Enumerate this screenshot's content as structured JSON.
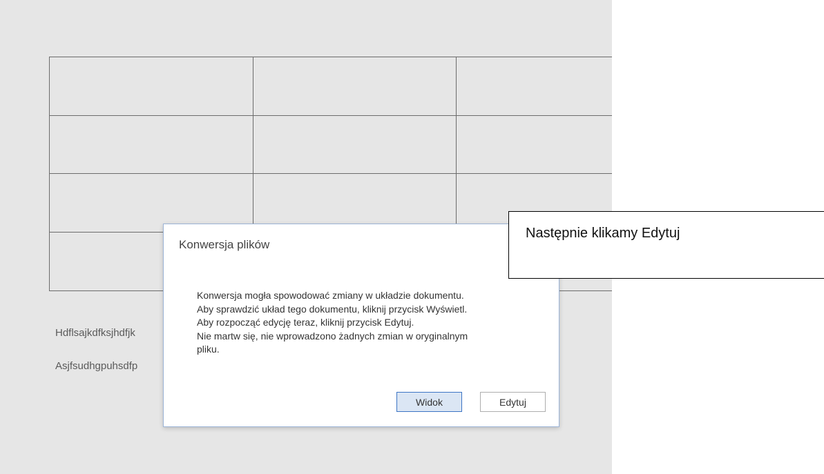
{
  "document": {
    "paragraphs": [
      "Hdflsajkdfksjhdfjk",
      "Asjfsudhgpuhsdfp"
    ]
  },
  "dialog": {
    "title": "Konwersja plików",
    "message_lines": [
      "Konwersja mogła spowodować zmiany w układzie dokumentu.",
      "Aby sprawdzić układ tego dokumentu, kliknij przycisk Wyświetl.",
      "Aby rozpocząć edycję teraz, kliknij przycisk Edytuj.",
      "Nie martw się, nie wprowadzono żadnych zmian w oryginalnym",
      "pliku."
    ],
    "buttons": {
      "view_label": "Widok",
      "edit_label": "Edytuj"
    }
  },
  "callout": {
    "text": "Następnie klikamy Edytuj"
  },
  "colors": {
    "document_background": "#e6e6e6",
    "primary_button_border": "#3c74c4",
    "primary_button_fill": "#dbe6f4"
  }
}
